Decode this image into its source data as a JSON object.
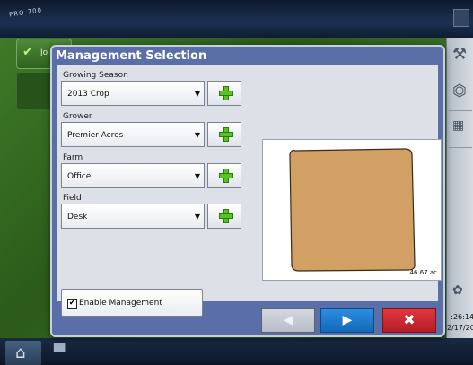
{
  "app": {
    "logo_text": "PRO 700",
    "background_item": {
      "label": "Jo"
    },
    "clock": {
      "time": ":26:14",
      "date": "2/17/20"
    },
    "colors": {
      "field_green": "#2f5a1f",
      "dialog_blue": "#5a6fa8",
      "add_green": "#58c41f",
      "next_blue": "#1e7fd0",
      "close_red": "#d02a31",
      "map_field": "#d2a064"
    }
  },
  "dialog": {
    "title": "Management Selection",
    "growing_season": {
      "label": "Growing Season",
      "value": "2013 Crop"
    },
    "grower": {
      "label": "Grower",
      "value": "Premier Acres"
    },
    "farm": {
      "label": "Farm",
      "value": "Office"
    },
    "field": {
      "label": "Field",
      "value": "Desk"
    },
    "enable_management": {
      "label": "Enable Management",
      "checked": true,
      "check_glyph": "✔"
    },
    "map": {
      "area_label": "46.67 ac"
    },
    "buttons": {
      "back_icon": "◀",
      "next_icon": "▶",
      "close_icon": "✖"
    },
    "combo_arrow": "▼"
  },
  "sidebar": {
    "icons": [
      "wrench-icon",
      "gps-receiver-icon",
      "calendar-icon",
      "product-icon"
    ]
  },
  "bottom": {
    "home_icon": "⌂",
    "camera_icon": "▀"
  }
}
